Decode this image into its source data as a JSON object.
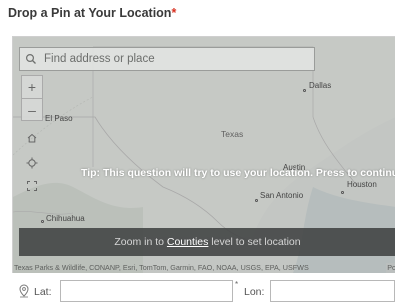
{
  "question": {
    "title": "Drop a Pin at Your Location",
    "required_mark": "*",
    "required_color": "#d83020"
  },
  "map": {
    "search": {
      "placeholder": "Find address or place",
      "value": "",
      "icon": "search-icon"
    },
    "controls": [
      {
        "icon": "plus-icon",
        "label": "+"
      },
      {
        "icon": "minus-icon",
        "label": "–"
      },
      {
        "icon": "home-icon"
      },
      {
        "icon": "locate-icon"
      },
      {
        "icon": "fullscreen-icon"
      }
    ],
    "labels": {
      "state": "Texas",
      "cities": [
        "Dallas",
        "El Paso",
        "Austin",
        "Houston",
        "San Antonio",
        "Chihuahua"
      ]
    },
    "tip": "Tip: This question will try to use your location. Press to continue.",
    "zoom_bar": {
      "prefix": "Zoom in to ",
      "link": "Counties",
      "suffix": " level to set location"
    },
    "attribution": "Texas Parks & Wildlife, CONANP, Esri, TomTom, Garmin, FAO, NOAA, USGS, EPA, USFWS",
    "powered_by": "Po"
  },
  "coordinates": {
    "icon": "pin-icon",
    "lat_label": "Lat:",
    "lat_value": "",
    "required_mark": "*",
    "lon_label": "Lon:",
    "lon_value": ""
  }
}
